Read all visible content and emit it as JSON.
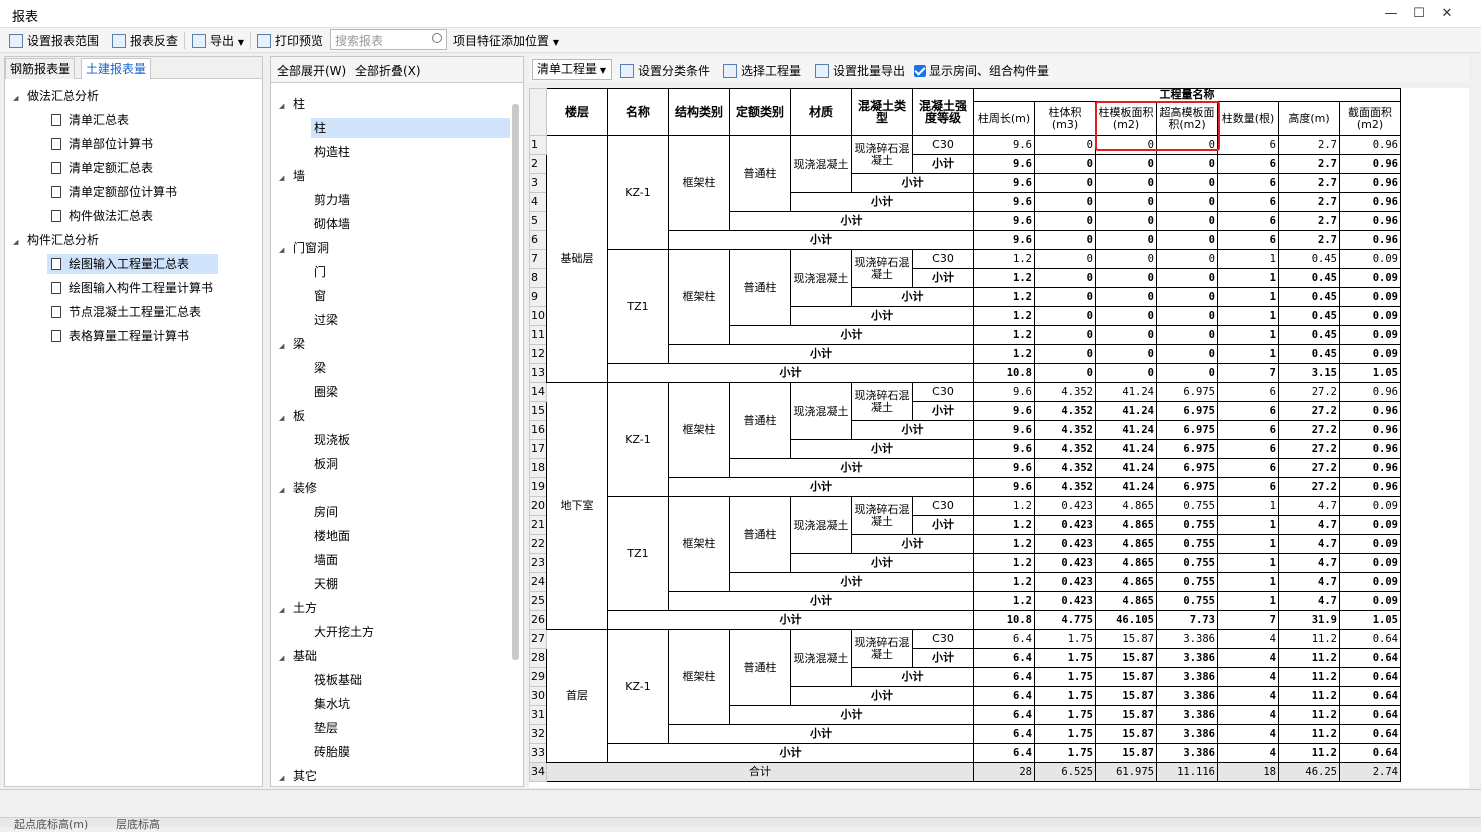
{
  "window": {
    "title": "报表"
  },
  "toolbar": {
    "set_range": "设置报表范围",
    "check": "报表反查",
    "export": "导出",
    "print_preview": "打印预览",
    "search_placeholder": "搜索报表",
    "feature_pos": "项目特征添加位置"
  },
  "left_tabs": [
    "钢筋报表量",
    "土建报表量"
  ],
  "left_tree": [
    {
      "label": "做法汇总分析",
      "level": 0
    },
    {
      "label": "清单汇总表",
      "level": 1
    },
    {
      "label": "清单部位计算书",
      "level": 1
    },
    {
      "label": "清单定额汇总表",
      "level": 1
    },
    {
      "label": "清单定额部位计算书",
      "level": 1
    },
    {
      "label": "构件做法汇总表",
      "level": 1
    },
    {
      "label": "构件汇总分析",
      "level": 0
    },
    {
      "label": "绘图输入工程量汇总表",
      "level": 1,
      "selected": true
    },
    {
      "label": "绘图输入构件工程量计算书",
      "level": 1
    },
    {
      "label": "节点混凝土工程量汇总表",
      "level": 1
    },
    {
      "label": "表格算量工程量计算书",
      "level": 1
    }
  ],
  "mid_head": {
    "expand_all": "全部展开(W)",
    "collapse_all": "全部折叠(X)"
  },
  "mid_tree": [
    {
      "label": "柱",
      "level": 0
    },
    {
      "label": "柱",
      "level": 1,
      "selected": true
    },
    {
      "label": "构造柱",
      "level": 1
    },
    {
      "label": "墙",
      "level": 0
    },
    {
      "label": "剪力墙",
      "level": 1
    },
    {
      "label": "砌体墙",
      "level": 1
    },
    {
      "label": "门窗洞",
      "level": 0
    },
    {
      "label": "门",
      "level": 1
    },
    {
      "label": "窗",
      "level": 1
    },
    {
      "label": "过梁",
      "level": 1
    },
    {
      "label": "梁",
      "level": 0
    },
    {
      "label": "梁",
      "level": 1
    },
    {
      "label": "圈梁",
      "level": 1
    },
    {
      "label": "板",
      "level": 0
    },
    {
      "label": "现浇板",
      "level": 1
    },
    {
      "label": "板洞",
      "level": 1
    },
    {
      "label": "装修",
      "level": 0
    },
    {
      "label": "房间",
      "level": 1
    },
    {
      "label": "楼地面",
      "level": 1
    },
    {
      "label": "墙面",
      "level": 1
    },
    {
      "label": "天棚",
      "level": 1
    },
    {
      "label": "土方",
      "level": 0
    },
    {
      "label": "大开挖土方",
      "level": 1
    },
    {
      "label": "基础",
      "level": 0
    },
    {
      "label": "筏板基础",
      "level": 1
    },
    {
      "label": "集水坑",
      "level": 1
    },
    {
      "label": "垫层",
      "level": 1
    },
    {
      "label": "砖胎膜",
      "level": 1
    },
    {
      "label": "其它",
      "level": 0
    }
  ],
  "right_toolbar": {
    "select_value": "清单工程量",
    "set_cond": "设置分类条件",
    "select_proj": "选择工程量",
    "batch_export": "设置批量导出",
    "show_room": "显示房间、组合构件量"
  },
  "table": {
    "group_header": "工程量名称",
    "headers": [
      "楼层",
      "名称",
      "结构类别",
      "定额类别",
      "材质",
      "混凝土类型",
      "混凝土强度等级",
      "柱周长(m)",
      "柱体积(m3)",
      "柱模板面积(m2)",
      "超高模板面积(m2)",
      "柱数量(根)",
      "高度(m)",
      "截面面积(m2)"
    ],
    "subtotal": "小计",
    "total_label": "合计",
    "floors": [
      "基础层",
      "地下室",
      "首层"
    ],
    "names": [
      "KZ-1",
      "TZ1",
      "KZ-1",
      "TZ1",
      "KZ-1"
    ],
    "struct": "框架柱",
    "quota": "普通柱",
    "material": "现浇混凝土",
    "concrete_type": "现浇碎石混凝土",
    "grade": "C30",
    "rows": [
      [
        "9.6",
        "0",
        "0",
        "0",
        "6",
        "2.7",
        "0.96"
      ],
      [
        "9.6",
        "0",
        "0",
        "0",
        "6",
        "2.7",
        "0.96"
      ],
      [
        "9.6",
        "0",
        "0",
        "0",
        "6",
        "2.7",
        "0.96"
      ],
      [
        "9.6",
        "0",
        "0",
        "0",
        "6",
        "2.7",
        "0.96"
      ],
      [
        "9.6",
        "0",
        "0",
        "0",
        "6",
        "2.7",
        "0.96"
      ],
      [
        "9.6",
        "0",
        "0",
        "0",
        "6",
        "2.7",
        "0.96"
      ],
      [
        "1.2",
        "0",
        "0",
        "0",
        "1",
        "0.45",
        "0.09"
      ],
      [
        "1.2",
        "0",
        "0",
        "0",
        "1",
        "0.45",
        "0.09"
      ],
      [
        "1.2",
        "0",
        "0",
        "0",
        "1",
        "0.45",
        "0.09"
      ],
      [
        "1.2",
        "0",
        "0",
        "0",
        "1",
        "0.45",
        "0.09"
      ],
      [
        "1.2",
        "0",
        "0",
        "0",
        "1",
        "0.45",
        "0.09"
      ],
      [
        "1.2",
        "0",
        "0",
        "0",
        "1",
        "0.45",
        "0.09"
      ],
      [
        "10.8",
        "0",
        "0",
        "0",
        "7",
        "3.15",
        "1.05"
      ],
      [
        "9.6",
        "4.352",
        "41.24",
        "6.975",
        "6",
        "27.2",
        "0.96"
      ],
      [
        "9.6",
        "4.352",
        "41.24",
        "6.975",
        "6",
        "27.2",
        "0.96"
      ],
      [
        "9.6",
        "4.352",
        "41.24",
        "6.975",
        "6",
        "27.2",
        "0.96"
      ],
      [
        "9.6",
        "4.352",
        "41.24",
        "6.975",
        "6",
        "27.2",
        "0.96"
      ],
      [
        "9.6",
        "4.352",
        "41.24",
        "6.975",
        "6",
        "27.2",
        "0.96"
      ],
      [
        "9.6",
        "4.352",
        "41.24",
        "6.975",
        "6",
        "27.2",
        "0.96"
      ],
      [
        "1.2",
        "0.423",
        "4.865",
        "0.755",
        "1",
        "4.7",
        "0.09"
      ],
      [
        "1.2",
        "0.423",
        "4.865",
        "0.755",
        "1",
        "4.7",
        "0.09"
      ],
      [
        "1.2",
        "0.423",
        "4.865",
        "0.755",
        "1",
        "4.7",
        "0.09"
      ],
      [
        "1.2",
        "0.423",
        "4.865",
        "0.755",
        "1",
        "4.7",
        "0.09"
      ],
      [
        "1.2",
        "0.423",
        "4.865",
        "0.755",
        "1",
        "4.7",
        "0.09"
      ],
      [
        "1.2",
        "0.423",
        "4.865",
        "0.755",
        "1",
        "4.7",
        "0.09"
      ],
      [
        "10.8",
        "4.775",
        "46.105",
        "7.73",
        "7",
        "31.9",
        "1.05"
      ],
      [
        "6.4",
        "1.75",
        "15.87",
        "3.386",
        "4",
        "11.2",
        "0.64"
      ],
      [
        "6.4",
        "1.75",
        "15.87",
        "3.386",
        "4",
        "11.2",
        "0.64"
      ],
      [
        "6.4",
        "1.75",
        "15.87",
        "3.386",
        "4",
        "11.2",
        "0.64"
      ],
      [
        "6.4",
        "1.75",
        "15.87",
        "3.386",
        "4",
        "11.2",
        "0.64"
      ],
      [
        "6.4",
        "1.75",
        "15.87",
        "3.386",
        "4",
        "11.2",
        "0.64"
      ],
      [
        "6.4",
        "1.75",
        "15.87",
        "3.386",
        "4",
        "11.2",
        "0.64"
      ],
      [
        "6.4",
        "1.75",
        "15.87",
        "3.386",
        "4",
        "11.2",
        "0.64"
      ],
      [
        "28",
        "6.525",
        "61.975",
        "11.116",
        "18",
        "46.25",
        "2.74"
      ]
    ]
  },
  "status": {
    "bottom_left": "起点底标高(m)",
    "bottom_left2": "层底标高"
  }
}
